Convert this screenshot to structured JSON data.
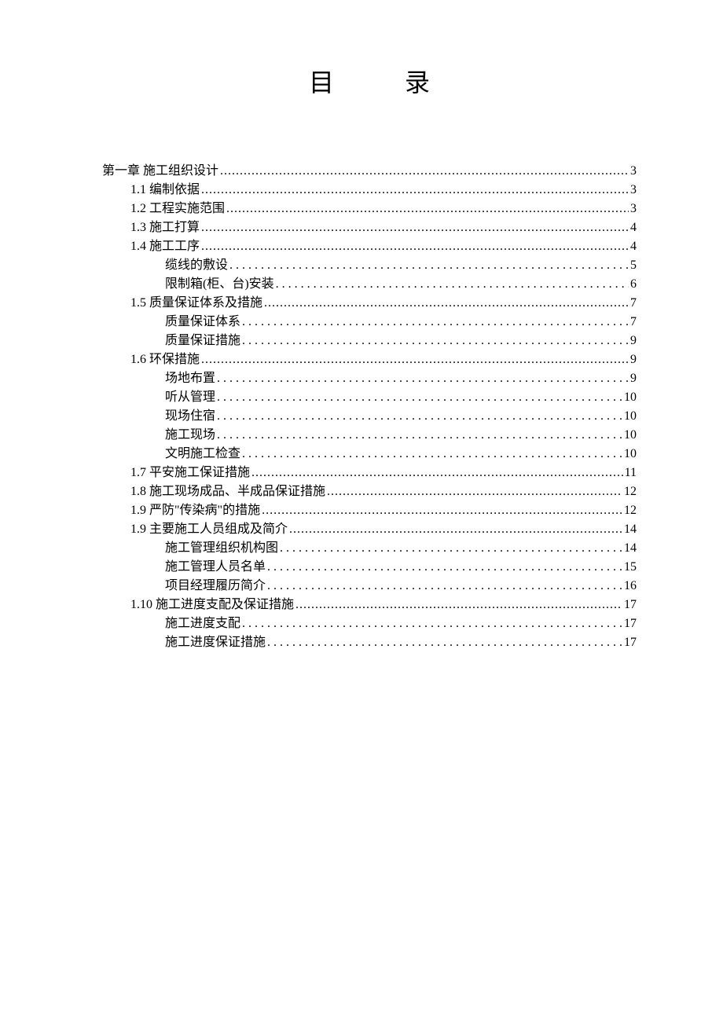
{
  "title": {
    "char1": "目",
    "char2": "录"
  },
  "toc": [
    {
      "label": "第一章 施工组织设计",
      "page": "3",
      "level": 0,
      "wide": false
    },
    {
      "label": "1.1 编制依据",
      "page": "3",
      "level": 1,
      "wide": false
    },
    {
      "label": "1.2 工程实施范围",
      "page": "3",
      "level": 1,
      "wide": false
    },
    {
      "label": "1.3 施工打算",
      "page": "4",
      "level": 1,
      "wide": false
    },
    {
      "label": "1.4 施工工序",
      "page": "4",
      "level": 1,
      "wide": false
    },
    {
      "label": "缆线的敷设",
      "page": "5",
      "level": 2,
      "wide": true
    },
    {
      "label": "限制箱(柜、台)安装",
      "page": "6",
      "level": 2,
      "wide": true
    },
    {
      "label": "1.5 质量保证体系及措施",
      "page": "7",
      "level": 1,
      "wide": false
    },
    {
      "label": "质量保证体系",
      "page": "7",
      "level": 2,
      "wide": true
    },
    {
      "label": "质量保证措施",
      "page": "9",
      "level": 2,
      "wide": true
    },
    {
      "label": "1.6 环保措施",
      "page": "9",
      "level": 1,
      "wide": false
    },
    {
      "label": "场地布置",
      "page": "9",
      "level": 2,
      "wide": true
    },
    {
      "label": "听从管理",
      "page": "10",
      "level": 2,
      "wide": true
    },
    {
      "label": "现场住宿",
      "page": "10",
      "level": 2,
      "wide": true
    },
    {
      "label": "施工现场",
      "page": "10",
      "level": 2,
      "wide": true
    },
    {
      "label": "文明施工检查",
      "page": "10",
      "level": 2,
      "wide": true
    },
    {
      "label": "1.7 平安施工保证措施",
      "page": "11",
      "level": 1,
      "wide": false
    },
    {
      "label": "1.8 施工现场成品、半成品保证措施",
      "page": "12",
      "level": 1,
      "wide": false
    },
    {
      "label": "1.9 严防\"传染病\"的措施",
      "page": "12",
      "level": 1,
      "wide": false
    },
    {
      "label": "1.9 主要施工人员组成及简介",
      "page": "14",
      "level": 1,
      "wide": false
    },
    {
      "label": "施工管理组织机构图",
      "page": "14",
      "level": 2,
      "wide": true
    },
    {
      "label": "施工管理人员名单",
      "page": "15",
      "level": 2,
      "wide": true
    },
    {
      "label": "项目经理履历简介",
      "page": "16",
      "level": 2,
      "wide": true
    },
    {
      "label": "1.10 施工进度支配及保证措施",
      "page": "17",
      "level": 1,
      "wide": false
    },
    {
      "label": "施工进度支配",
      "page": "17",
      "level": 2,
      "wide": true
    },
    {
      "label": "施工进度保证措施",
      "page": "17",
      "level": 2,
      "wide": true
    }
  ]
}
